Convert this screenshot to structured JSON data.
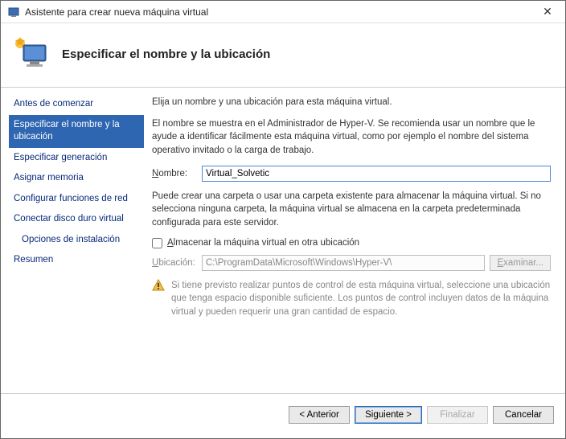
{
  "window": {
    "title": "Asistente para crear nueva máquina virtual"
  },
  "header": {
    "title": "Especificar el nombre y la ubicación"
  },
  "sidebar": {
    "items": [
      {
        "label": "Antes de comenzar"
      },
      {
        "label": "Especificar el nombre y la ubicación",
        "selected": true
      },
      {
        "label": "Especificar generación"
      },
      {
        "label": "Asignar memoria"
      },
      {
        "label": "Configurar funciones de red"
      },
      {
        "label": "Conectar disco duro virtual"
      },
      {
        "label": "Opciones de instalación",
        "sub": true
      },
      {
        "label": "Resumen"
      }
    ]
  },
  "main": {
    "intro": "Elija un nombre y una ubicación para esta máquina virtual.",
    "desc": "El nombre se muestra en el Administrador de Hyper-V. Se recomienda usar un nombre que le ayude a identificar fácilmente esta máquina virtual, como por ejemplo el nombre del sistema operativo invitado o la carga de trabajo.",
    "name_label": "Nombre:",
    "name_value": "Virtual_Solvetic",
    "folder_desc": "Puede crear una carpeta o usar una carpeta existente para almacenar la máquina virtual. Si no selecciona ninguna carpeta, la máquina virtual se almacena en la carpeta predeterminada configurada para este servidor.",
    "store_checkbox": "Almacenar la máquina virtual en otra ubicación",
    "location_label": "Ubicación:",
    "location_value": "C:\\ProgramData\\Microsoft\\Windows\\Hyper-V\\",
    "browse": "Examinar...",
    "warning": "Si tiene previsto realizar puntos de control de esta máquina virtual, seleccione una ubicación que tenga espacio disponible suficiente. Los puntos de control incluyen datos de la máquina virtual y pueden requerir una gran cantidad de espacio."
  },
  "footer": {
    "prev": "< Anterior",
    "next": "Siguiente >",
    "finish": "Finalizar",
    "cancel": "Cancelar"
  }
}
